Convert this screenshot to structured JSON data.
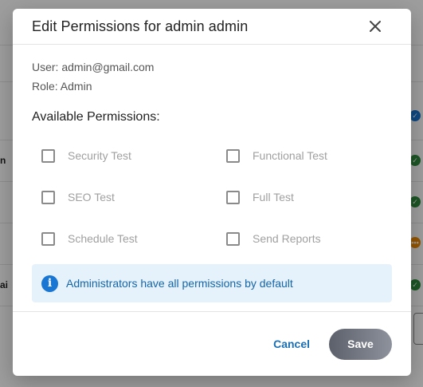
{
  "background": {
    "rows": [
      {
        "text": "n",
        "status": "check"
      },
      {
        "text": "",
        "status": "check"
      },
      {
        "text": "",
        "status": "pending"
      },
      {
        "text": "ai",
        "status": "check"
      }
    ]
  },
  "dialog": {
    "title": "Edit Permissions for admin admin",
    "user_line": "User: admin@gmail.com",
    "role_line": "Role: Admin",
    "section_title": "Available Permissions:",
    "permissions": [
      {
        "label": "Security Test",
        "checked": false
      },
      {
        "label": "Functional Test",
        "checked": false
      },
      {
        "label": "SEO Test",
        "checked": false
      },
      {
        "label": "Full Test",
        "checked": false
      },
      {
        "label": "Schedule Test",
        "checked": false
      },
      {
        "label": "Send Reports",
        "checked": false
      }
    ],
    "info_icon": "info-icon",
    "info_message": "Administrators have all permissions by default",
    "cancel_label": "Cancel",
    "save_label": "Save"
  },
  "colors": {
    "accent": "#1976d2",
    "link": "#1a6fb5",
    "info_bg": "#e6f2fb",
    "status_check": "#2e8b3d",
    "status_pending": "#f08c00"
  }
}
